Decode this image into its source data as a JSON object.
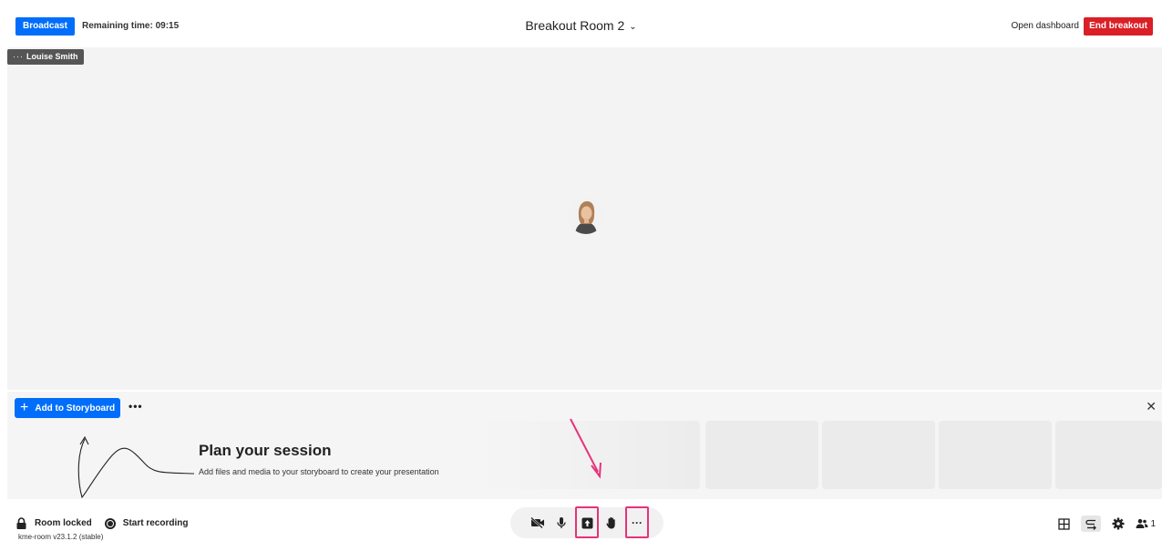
{
  "topbar": {
    "broadcast_label": "Broadcast",
    "remaining_time": "Remaining time: 09:15",
    "room_title": "Breakout Room 2",
    "open_dashboard": "Open dashboard",
    "end_breakout": "End breakout"
  },
  "stage": {
    "participant_name": "Louise Smith",
    "participant_menu_icon": "ellipsis-icon"
  },
  "storyboard": {
    "add_label": "Add to Storyboard",
    "more_label": "•••",
    "close_label": "✕",
    "plan_title": "Plan your session",
    "plan_subtitle": "Add files and media to your storyboard to create your presentation"
  },
  "footer": {
    "room_locked": "Room locked",
    "start_recording": "Start recording",
    "version": "kme-room v23.1.2 (stable)",
    "participant_count": "1",
    "more_label": "···"
  },
  "controls": [
    "camera-off-icon",
    "microphone-icon",
    "share-upload-icon",
    "raise-hand-icon",
    "more-icon"
  ],
  "colors": {
    "primary": "#006efa",
    "danger": "#da1f26",
    "highlight": "#e5337a"
  }
}
